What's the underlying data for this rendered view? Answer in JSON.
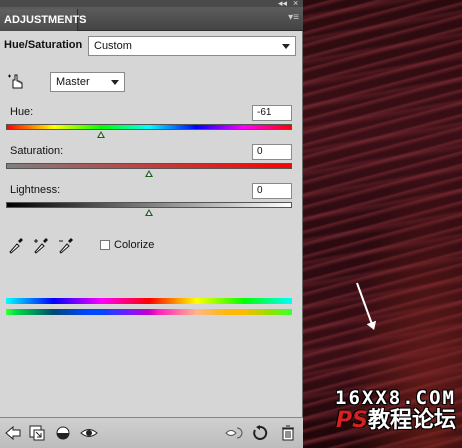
{
  "panel": {
    "tab_label": "ADJUSTMENTS",
    "title": "Hue/Saturation",
    "preset": {
      "selected": "Custom"
    },
    "channel": {
      "selected": "Master"
    },
    "sliders": [
      {
        "label": "Hue:",
        "value": "-61",
        "min": -180,
        "max": 180,
        "numeric": -61
      },
      {
        "label": "Saturation:",
        "value": "0",
        "min": -100,
        "max": 100,
        "numeric": 0
      },
      {
        "label": "Lightness:",
        "value": "0",
        "min": -100,
        "max": 100,
        "numeric": 0
      }
    ],
    "colorize_label": "Colorize",
    "colorize_checked": false,
    "icons": {
      "on_image_adjust": "hand-finger-icon",
      "eyedroppers": [
        "eyedropper-icon",
        "eyedropper-plus-icon",
        "eyedropper-minus-icon"
      ],
      "bottom_left": [
        "back-arrow-icon",
        "clip-to-layer-icon",
        "layer-visibility-mask-icon",
        "eye-icon"
      ],
      "bottom_right": [
        "view-previous-icon",
        "reset-icon",
        "trash-icon"
      ]
    }
  },
  "watermark": {
    "line1": "16XX8.COM",
    "line2_latin": "PS",
    "line2_cn": "教程论坛"
  },
  "colors": {
    "panel_bg": "#d6d6d6",
    "tab_bg": "#4c4c4c",
    "thumb": "#1e5e1e",
    "canvas": "#3b0f16"
  }
}
